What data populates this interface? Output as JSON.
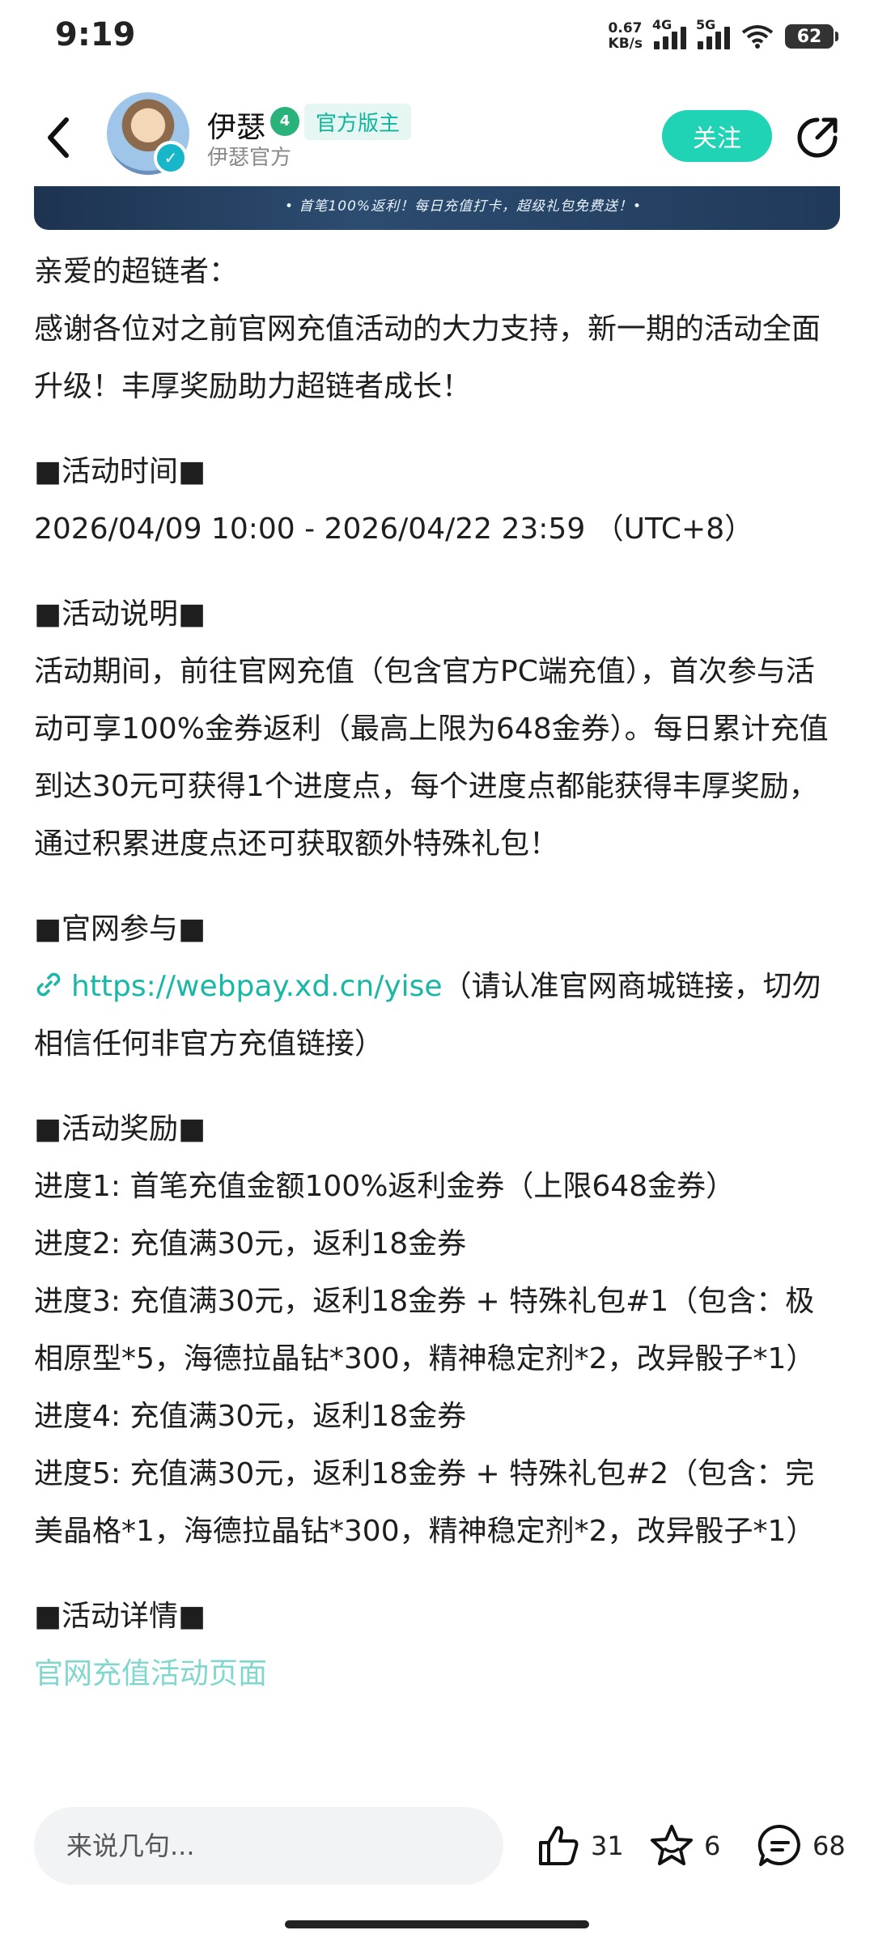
{
  "status_bar": {
    "time": "9:19",
    "net_speed_value": "0.67",
    "net_speed_unit": "KB/s",
    "sim1_label": "4G",
    "sim2_label": "5G",
    "battery": "62"
  },
  "header": {
    "username": "伊瑟",
    "level_badge": "4",
    "official_badge": "官方版主",
    "subtitle": "伊瑟官方",
    "follow_label": "关注"
  },
  "banner_text": "• 首笔100%返利！每日充值打卡，超级礼包免费送！•",
  "article": {
    "greeting": "亲爱的超链者：",
    "intro": "感谢各位对之前官网充值活动的大力支持，新一期的活动全面升级！丰厚奖励助力超链者成长！",
    "time_heading": "■活动时间■",
    "time_text": "2026/04/09 10:00 - 2026/04/22 23:59 （UTC+8）",
    "desc_heading": "■活动说明■",
    "desc_text": "活动期间，前往官网充值（包含官方PC端充值），首次参与活动可享100%金券返利（最高上限为648金券）。每日累计充值到达30元可获得1个进度点，每个进度点都能获得丰厚奖励，通过积累进度点还可获取额外特殊礼包！",
    "join_heading": "■官网参与■",
    "link_url": "https://webpay.xd.cn/yise",
    "link_note": "（请认准官网商城链接，切勿相信任何非官方充值链接）",
    "rewards_heading": "■活动奖励■",
    "rewards": [
      "进度1: 首笔充值金额100%返利金券（上限648金券）",
      "进度2: 充值满30元，返利18金券",
      "进度3: 充值满30元，返利18金券 + 特殊礼包#1（包含：极相原型*5，海德拉晶钻*300，精神稳定剂*2，改异骰子*1）",
      "进度4: 充值满30元，返利18金券",
      "进度5: 充值满30元，返利18金券 + 特殊礼包#2（包含：完美晶格*1，海德拉晶钻*300，精神稳定剂*2，改异骰子*1）"
    ],
    "details_heading": "■活动详情■",
    "details_link_partial": "官网充值活动页面"
  },
  "bottom_bar": {
    "comment_placeholder": "来说几句...",
    "like_count": "31",
    "favorite_count": "6",
    "comment_count": "68"
  },
  "colors": {
    "accent": "#1fd3b4",
    "link": "#19b7a6",
    "level_badge": "#2ab27b"
  }
}
